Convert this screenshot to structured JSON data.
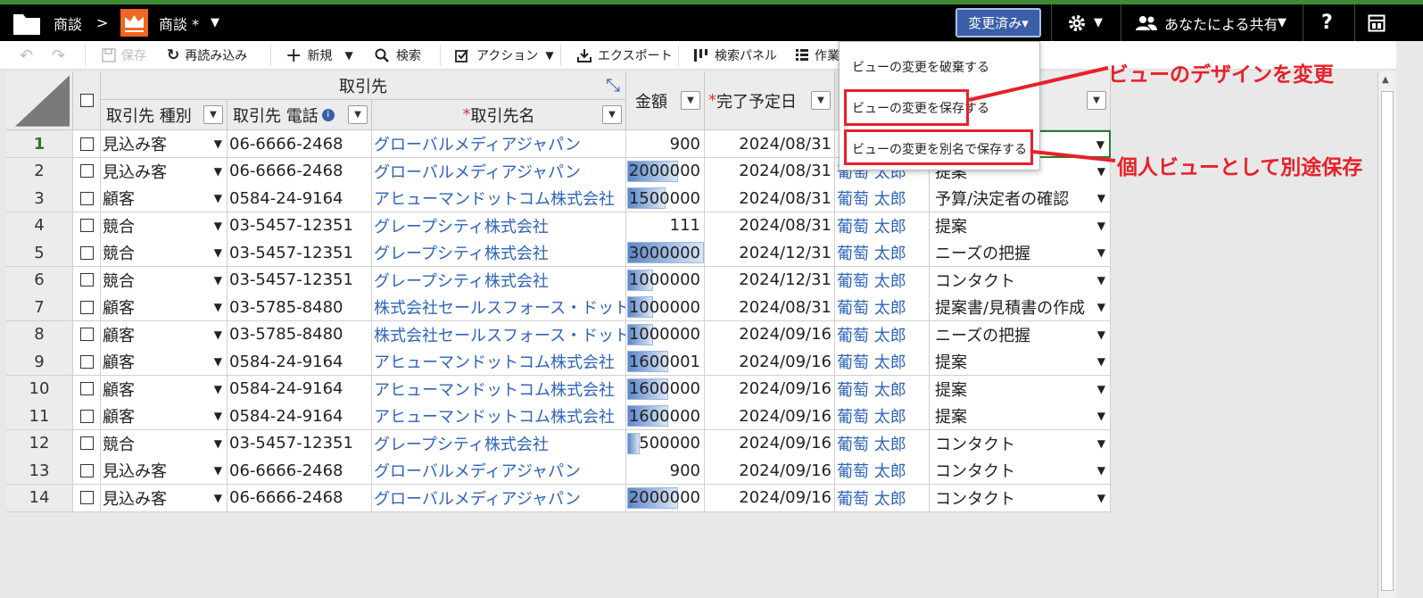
{
  "topbar": {
    "breadcrumb_app": "商談",
    "breadcrumb_sep": ">",
    "view_name": "商談 *",
    "changed_button": "変更済み▾",
    "share_label": "あなたによる共有",
    "help": "?"
  },
  "toolbar": {
    "save": "保存",
    "reload": "再読み込み",
    "new": "新規",
    "search": "検索",
    "action": "アクション",
    "export": "エクスポート",
    "search_panel": "検索パネル",
    "work": "作業"
  },
  "menu": {
    "discard": "ビューの変更を破棄する",
    "save": "ビューの変更を保存する",
    "save_as": "ビューの変更を別名で保存する"
  },
  "annotations": {
    "design": "ビューのデザインを変更",
    "personal": "個人ビューとして別途保存"
  },
  "grid": {
    "group_header": "取引先",
    "headers": {
      "type": "取引先 種別",
      "phone": "取引先 電話",
      "req_mark": "*",
      "name": "取引先名",
      "amount": "金額",
      "close_date": "完了予定日"
    },
    "rows": [
      {
        "no": "1",
        "type": "見込み客",
        "phone": "06-6666-2468",
        "name": "グローバルメディアジャパン",
        "amount": "900",
        "amount_ratio": 0.0003,
        "date": "2024/08/31",
        "owner": "",
        "stage": ""
      },
      {
        "no": "2",
        "type": "見込み客",
        "phone": "06-6666-2468",
        "name": "グローバルメディアジャパン",
        "amount": "2000000",
        "amount_ratio": 0.667,
        "date": "2024/08/31",
        "owner": "葡萄 太郎",
        "stage": "提案"
      },
      {
        "no": "3",
        "type": "顧客",
        "phone": "0584-24-9164",
        "name": "アヒューマンドットコム株式会社",
        "amount": "1500000",
        "amount_ratio": 0.5,
        "date": "2024/08/31",
        "owner": "葡萄 太郎",
        "stage": "予算/決定者の確認"
      },
      {
        "no": "4",
        "type": "競合",
        "phone": "03-5457-12351",
        "name": "グレープシティ株式会社",
        "amount": "111",
        "amount_ratio": 0,
        "date": "2024/08/31",
        "owner": "葡萄 太郎",
        "stage": "提案"
      },
      {
        "no": "5",
        "type": "競合",
        "phone": "03-5457-12351",
        "name": "グレープシティ株式会社",
        "amount": "3000000",
        "amount_ratio": 1,
        "date": "2024/12/31",
        "owner": "葡萄 太郎",
        "stage": "ニーズの把握"
      },
      {
        "no": "6",
        "type": "競合",
        "phone": "03-5457-12351",
        "name": "グレープシティ株式会社",
        "amount": "1000000",
        "amount_ratio": 0.333,
        "date": "2024/12/31",
        "owner": "葡萄 太郎",
        "stage": "コンタクト"
      },
      {
        "no": "7",
        "type": "顧客",
        "phone": "03-5785-8480",
        "name": "株式会社セールスフォース・ドットコム",
        "amount": "1000000",
        "amount_ratio": 0.333,
        "date": "2024/08/31",
        "owner": "葡萄 太郎",
        "stage": "提案書/見積書の作成"
      },
      {
        "no": "8",
        "type": "顧客",
        "phone": "03-5785-8480",
        "name": "株式会社セールスフォース・ドットコム",
        "amount": "1000000",
        "amount_ratio": 0.333,
        "date": "2024/09/16",
        "owner": "葡萄 太郎",
        "stage": "ニーズの把握"
      },
      {
        "no": "9",
        "type": "顧客",
        "phone": "0584-24-9164",
        "name": "アヒューマンドットコム株式会社",
        "amount": "1600001",
        "amount_ratio": 0.533,
        "date": "2024/09/16",
        "owner": "葡萄 太郎",
        "stage": "提案"
      },
      {
        "no": "10",
        "type": "顧客",
        "phone": "0584-24-9164",
        "name": "アヒューマンドットコム株式会社",
        "amount": "1600000",
        "amount_ratio": 0.533,
        "date": "2024/09/16",
        "owner": "葡萄 太郎",
        "stage": "提案"
      },
      {
        "no": "11",
        "type": "顧客",
        "phone": "0584-24-9164",
        "name": "アヒューマンドットコム株式会社",
        "amount": "1600000",
        "amount_ratio": 0.533,
        "date": "2024/09/16",
        "owner": "葡萄 太郎",
        "stage": "提案"
      },
      {
        "no": "12",
        "type": "競合",
        "phone": "03-5457-12351",
        "name": "グレープシティ株式会社",
        "amount": "500000",
        "amount_ratio": 0.167,
        "date": "2024/09/16",
        "owner": "葡萄 太郎",
        "stage": "コンタクト"
      },
      {
        "no": "13",
        "type": "見込み客",
        "phone": "06-6666-2468",
        "name": "グローバルメディアジャパン",
        "amount": "900",
        "amount_ratio": 0,
        "date": "2024/09/16",
        "owner": "葡萄 太郎",
        "stage": "コンタクト"
      },
      {
        "no": "14",
        "type": "見込み客",
        "phone": "06-6666-2468",
        "name": "グローバルメディアジャパン",
        "amount": "2000000",
        "amount_ratio": 0.667,
        "date": "2024/09/16",
        "owner": "葡萄 太郎",
        "stage": "コンタクト"
      }
    ]
  },
  "colors": {
    "accent_red": "#e8202a",
    "link_blue": "#2f64b9",
    "bar_blue": "#5b86c9",
    "active_green": "#2a7d2a"
  }
}
